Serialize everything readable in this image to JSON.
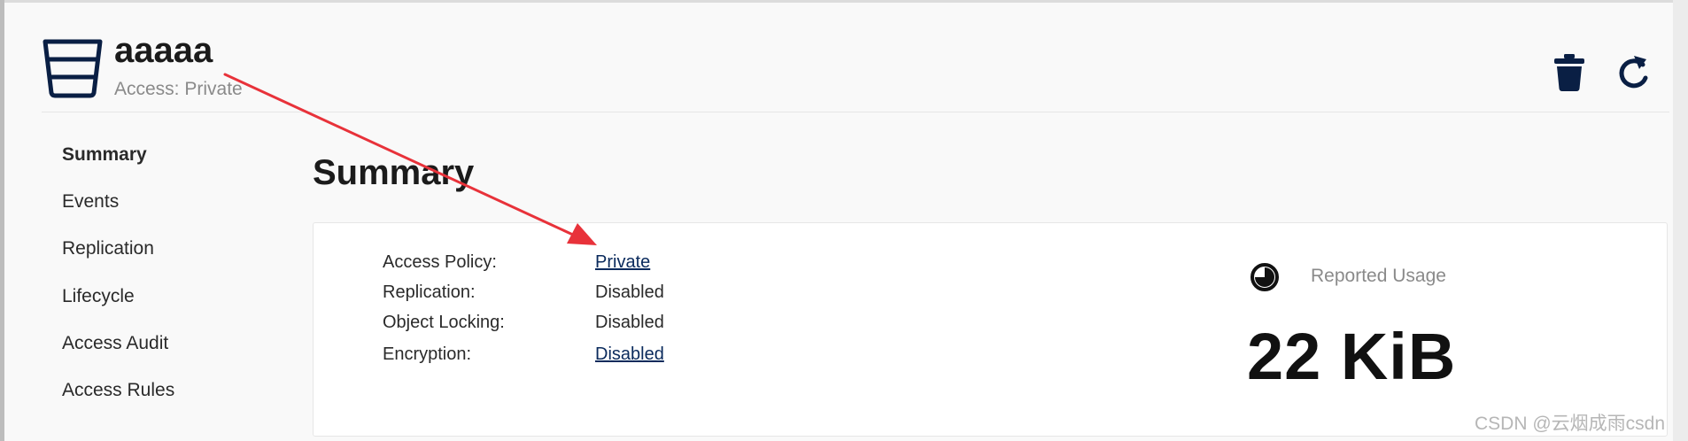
{
  "bucket": {
    "name": "aaaaa",
    "access_subtitle": "Access: Private"
  },
  "toolbar": {
    "delete_icon": "trash-icon",
    "refresh_icon": "refresh-icon"
  },
  "sidebar": {
    "items": [
      {
        "label": "Summary",
        "active": true
      },
      {
        "label": "Events"
      },
      {
        "label": "Replication"
      },
      {
        "label": "Lifecycle"
      },
      {
        "label": "Access Audit"
      },
      {
        "label": "Access Rules"
      }
    ]
  },
  "main": {
    "title": "Summary",
    "properties": [
      {
        "label": "Access Policy:",
        "value": "Private",
        "link": true
      },
      {
        "label": "Replication:",
        "value": "Disabled",
        "link": false
      },
      {
        "label": "Object Locking:",
        "value": "Disabled",
        "link": false
      },
      {
        "label": "Encryption:",
        "value": "Disabled",
        "link": true
      }
    ],
    "usage": {
      "icon": "pie-chart-icon",
      "label": "Reported Usage",
      "value": "22 KiB"
    }
  },
  "annotation": {
    "arrow_color": "#e8323a"
  },
  "watermark": "CSDN @云烟成雨csdn",
  "colors": {
    "icon_navy": "#0a1f44",
    "link_navy": "#0a2a5c"
  }
}
